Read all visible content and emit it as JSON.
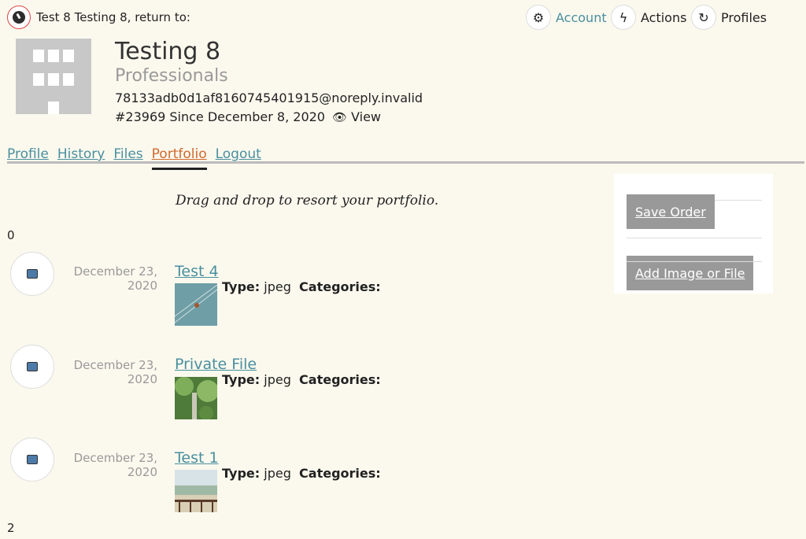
{
  "topbar": {
    "return_text": "Test 8 Testing 8, return to:",
    "nav": [
      {
        "label": "Account",
        "icon": "gear-icon"
      },
      {
        "label": "Actions",
        "icon": "lightning-icon"
      },
      {
        "label": "Profiles",
        "icon": "refresh-icon"
      }
    ]
  },
  "profile": {
    "name": "Testing 8",
    "type": "Professionals",
    "email": "78133adb0d1af8160745401915@noreply.invalid",
    "meta": "#23969 Since December 8, 2020",
    "view_label": "View"
  },
  "tabs": [
    {
      "label": "Profile",
      "active": false
    },
    {
      "label": "History",
      "active": false
    },
    {
      "label": "Files",
      "active": false
    },
    {
      "label": "Portfolio",
      "active": true
    },
    {
      "label": "Logout",
      "active": false
    }
  ],
  "portfolio": {
    "instruction": "Drag and drop to resort your portfolio.",
    "marker_top": "0",
    "marker_bottom": "2",
    "items": [
      {
        "date_line1": "December 23,",
        "date_line2": "2020",
        "title": "Test 4",
        "type_label": "Type:",
        "type_value": "jpeg",
        "categories_label": "Categories:"
      },
      {
        "date_line1": "December 23,",
        "date_line2": "2020",
        "title": "Private File",
        "type_label": "Type:",
        "type_value": "jpeg",
        "categories_label": "Categories:"
      },
      {
        "date_line1": "December 23,",
        "date_line2": "2020",
        "title": "Test 1",
        "type_label": "Type:",
        "type_value": "jpeg",
        "categories_label": "Categories:"
      }
    ]
  },
  "sidebar": {
    "save_order": "Save Order",
    "add_image": "Add Image or File"
  },
  "colors": {
    "background": "#fbf9ee",
    "link": "#4a8f9f",
    "active_tab": "#d0692e",
    "button": "#999999"
  }
}
